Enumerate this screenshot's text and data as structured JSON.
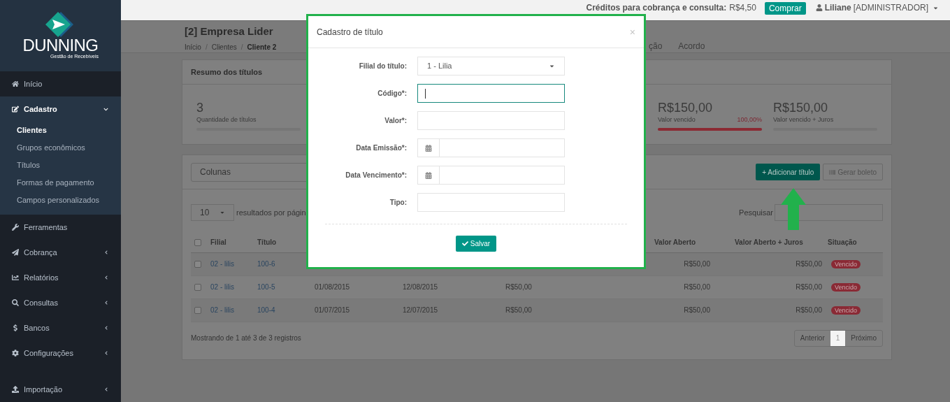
{
  "logo": {
    "name": "DUNNING",
    "tagline": "Gestão de Recebíveis"
  },
  "top_bar": {
    "credits_label": "Créditos para cobrança e consulta:",
    "credits_value": "R$4,50",
    "buy_button": "Comprar",
    "user_name": "Liliane",
    "user_role": "[ADMINISTRADOR]"
  },
  "sidebar": {
    "items": [
      {
        "label": "Início",
        "kind": "link",
        "expanded": false
      },
      {
        "label": "Cadastro",
        "kind": "menu",
        "expanded": true,
        "children": [
          {
            "label": "Clientes",
            "selected": true
          },
          {
            "label": "Grupos econômicos",
            "selected": false
          },
          {
            "label": "Títulos",
            "selected": false
          },
          {
            "label": "Formas de pagamento",
            "selected": false
          },
          {
            "label": "Campos personalizados",
            "selected": false
          }
        ]
      },
      {
        "label": "Ferramentas",
        "kind": "link",
        "expanded": false
      },
      {
        "label": "Cobrança",
        "kind": "menu",
        "expanded": false
      },
      {
        "label": "Relatórios",
        "kind": "menu",
        "expanded": false
      },
      {
        "label": "Consultas",
        "kind": "menu",
        "expanded": false
      },
      {
        "label": "Bancos",
        "kind": "menu",
        "expanded": false
      },
      {
        "label": "Configurações",
        "kind": "menu",
        "expanded": false
      },
      {
        "label": "Importação",
        "kind": "menu",
        "expanded": false
      }
    ]
  },
  "page_header": {
    "title": "[2] Empresa Lider",
    "breadcrumb_separator": "/",
    "breadcrumb": [
      {
        "label": "Início",
        "selected": false
      },
      {
        "label": "Clientes",
        "selected": false
      },
      {
        "label": "Cliente 2",
        "selected": true
      }
    ],
    "tabs": [
      {
        "label": "ção",
        "selected": false
      },
      {
        "label": "Acordo",
        "selected": false
      }
    ]
  },
  "summary": {
    "title": "Resumo dos títulos",
    "cards": [
      {
        "value": "3",
        "label": "Quantidade de títulos",
        "level": 0
      },
      {
        "value": "R$150,00",
        "label": "Valor vencido",
        "percent": "100,00%",
        "level": 1
      },
      {
        "value": "R$150,00",
        "label": "Valor vencido + Juros",
        "level": 0
      }
    ]
  },
  "table_panel": {
    "columns_select": "Colunas",
    "add_button": "+ Adicionar título",
    "boleto_button": {
      "label": "Gerar boleto",
      "disabled": true
    },
    "page_size": "10",
    "page_size_text": "resultados por págin",
    "search_label": "Pesquisar",
    "table": {
      "all_checked": false,
      "columns": [
        {
          "label": "Filial"
        },
        {
          "label": "Título"
        },
        {},
        {},
        {},
        {
          "label": "Valor Aberto"
        },
        {
          "label": "Valor Aberto + Juros"
        },
        {
          "label": "Situação"
        }
      ],
      "rows": [
        {
          "checked": false,
          "cells": [
            "02 - lilis",
            "100-6",
            null,
            null,
            null,
            "R$50,00",
            "R$50,00"
          ],
          "status": "Vencido"
        },
        {
          "checked": false,
          "cells": [
            "02 - lilis",
            "100-5",
            "01/08/2015",
            "12/08/2015",
            "R$50,00",
            "R$50,00",
            "R$50,00"
          ],
          "status": "Vencido"
        },
        {
          "checked": false,
          "cells": [
            "02 - lilis",
            "100-4",
            "01/07/2015",
            "12/07/2015",
            "R$50,00",
            "R$50,00",
            "R$50,00"
          ],
          "status": "Vencido"
        }
      ]
    },
    "footer": "Mostrando de 1 até 3 de 3 registros",
    "pagination": [
      {
        "label": "Anterior",
        "selected": false
      },
      {
        "label": "1",
        "selected": true
      },
      {
        "label": "Próximo",
        "selected": false
      }
    ]
  },
  "modal": {
    "title": "Cadastro de título",
    "close": "×",
    "fields": [
      {
        "label": "Filial do título:",
        "kind": "select",
        "value": "1 - Lilia",
        "focused": false
      },
      {
        "label": "Código*:",
        "kind": "text",
        "focused": true
      },
      {
        "label": "Valor*:",
        "kind": "text",
        "focused": false
      },
      {
        "label": "Data Emissão*:",
        "kind": "date",
        "focused": false
      },
      {
        "label": "Data Vencimento*:",
        "kind": "date",
        "focused": false
      },
      {
        "label": "Tipo:",
        "kind": "text",
        "focused": false
      }
    ],
    "save_button": "Salvar"
  }
}
